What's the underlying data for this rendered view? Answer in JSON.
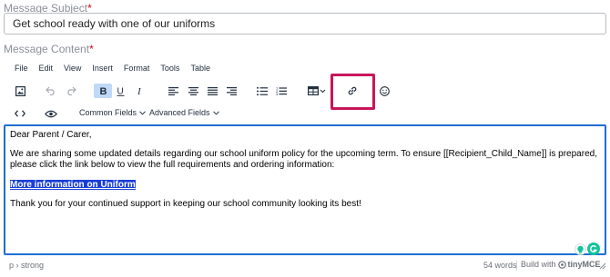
{
  "subject": {
    "label": "Message Subject",
    "required_mark": "*",
    "value": "Get school ready with one of our uniforms"
  },
  "content_field": {
    "label": "Message Content",
    "required_mark": "*"
  },
  "menubar": {
    "items": [
      "File",
      "Edit",
      "View",
      "Insert",
      "Format",
      "Tools",
      "Table"
    ]
  },
  "toolbar": {
    "icons": [
      "image-icon",
      "undo-icon",
      "redo-icon",
      "bold-icon",
      "underline-icon",
      "italic-icon",
      "align-left-icon",
      "align-center-icon",
      "align-justify-icon",
      "align-right-icon",
      "bullet-list-icon",
      "numbered-list-icon",
      "table-icon",
      "link-icon",
      "emoji-icon",
      "source-code-icon",
      "preview-icon"
    ],
    "common_fields": "Common Fields",
    "advanced_fields": "Advanced Fields",
    "highlight_color": "#c8155a"
  },
  "body": {
    "greeting": "Dear Parent / Carer,",
    "intro": "We are sharing some updated details regarding our school uniform policy for the upcoming term. To ensure [[Recipient_Child_Name]] is prepared, please click the link below to view the full requirements and ordering information:",
    "link_text": "More information on Uniform",
    "closing": "Thank you for your continued support in keeping our school community looking its best!"
  },
  "statusbar": {
    "path": "p › strong",
    "word_count": "54 words",
    "build_prefix": "Build with",
    "brand": "tinyMCE"
  },
  "colors": {
    "focus_border": "#1f6ed4",
    "selection": "#1a3fd6",
    "active_button": "#bfd9f6",
    "grammar_badge": "#15c39a"
  }
}
